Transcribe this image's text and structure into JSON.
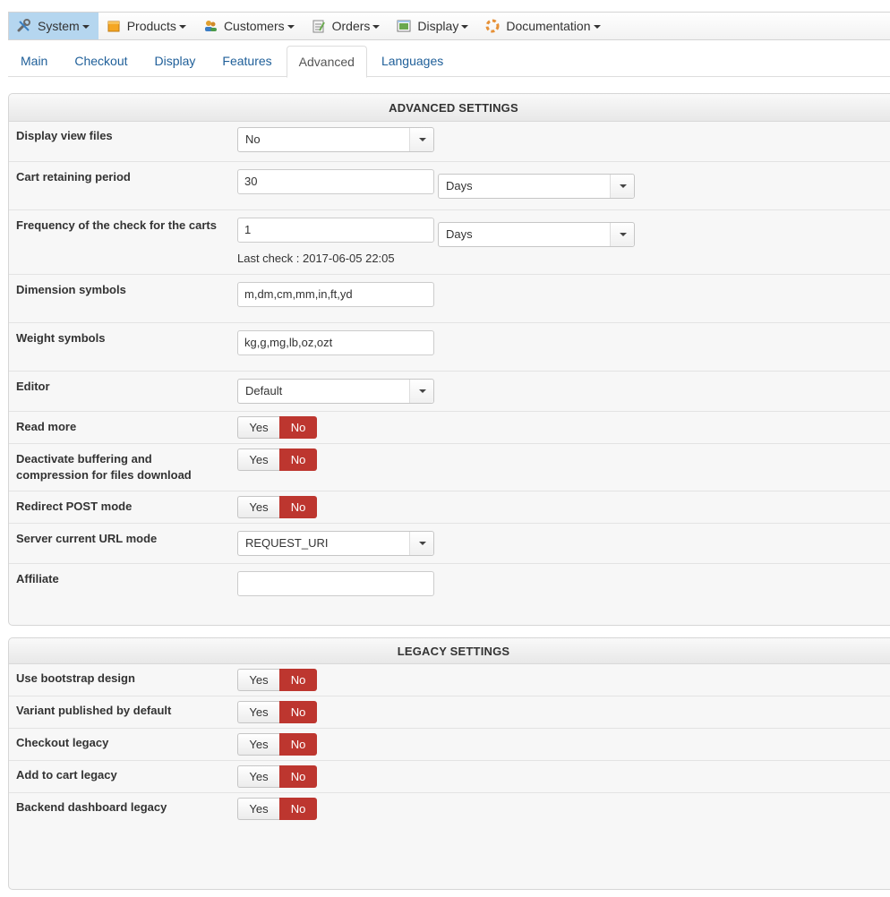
{
  "menu": {
    "items": [
      {
        "label": "System",
        "icon": "wrench-icon"
      },
      {
        "label": "Products",
        "icon": "box-icon"
      },
      {
        "label": "Customers",
        "icon": "users-icon"
      },
      {
        "label": "Orders",
        "icon": "orders-icon"
      },
      {
        "label": "Display",
        "icon": "display-icon"
      },
      {
        "label": "Documentation",
        "icon": "help-icon"
      }
    ]
  },
  "tabs": [
    "Main",
    "Checkout",
    "Display",
    "Features",
    "Advanced",
    "Languages"
  ],
  "advanced": {
    "title": "ADVANCED SETTINGS",
    "display_view_files": {
      "label": "Display view files",
      "value": "No"
    },
    "cart_retaining": {
      "label": "Cart retaining period",
      "value": "30",
      "unit": "Days"
    },
    "check_frequency": {
      "label": "Frequency of the check for the carts",
      "value": "1",
      "unit": "Days",
      "last_check": "Last check : 2017-06-05 22:05"
    },
    "dimension_symbols": {
      "label": "Dimension symbols",
      "value": "m,dm,cm,mm,in,ft,yd"
    },
    "weight_symbols": {
      "label": "Weight symbols",
      "value": "kg,g,mg,lb,oz,ozt"
    },
    "editor": {
      "label": "Editor",
      "value": "Default"
    },
    "read_more": {
      "label": "Read more",
      "yes": "Yes",
      "no": "No"
    },
    "deactivate_buffering": {
      "label_line1": "Deactivate buffering and",
      "label_line2": "compression for files download",
      "yes": "Yes",
      "no": "No"
    },
    "redirect_post": {
      "label": "Redirect POST mode",
      "yes": "Yes",
      "no": "No"
    },
    "server_url_mode": {
      "label": "Server current URL mode",
      "value": "REQUEST_URI"
    },
    "affiliate": {
      "label": "Affiliate",
      "value": ""
    }
  },
  "legacy": {
    "title": "LEGACY SETTINGS",
    "use_bootstrap": {
      "label": "Use bootstrap design",
      "yes": "Yes",
      "no": "No"
    },
    "variant_published": {
      "label": "Variant published by default",
      "yes": "Yes",
      "no": "No"
    },
    "checkout_legacy": {
      "label": "Checkout legacy",
      "yes": "Yes",
      "no": "No"
    },
    "add_to_cart_legacy": {
      "label": "Add to cart legacy",
      "yes": "Yes",
      "no": "No"
    },
    "dashboard_legacy": {
      "label": "Backend dashboard legacy",
      "yes": "Yes",
      "no": "No"
    }
  },
  "colors": {
    "active_menu": "#b5d6ef",
    "toggle_no": "#bd362f",
    "link": "#1f5f99"
  }
}
